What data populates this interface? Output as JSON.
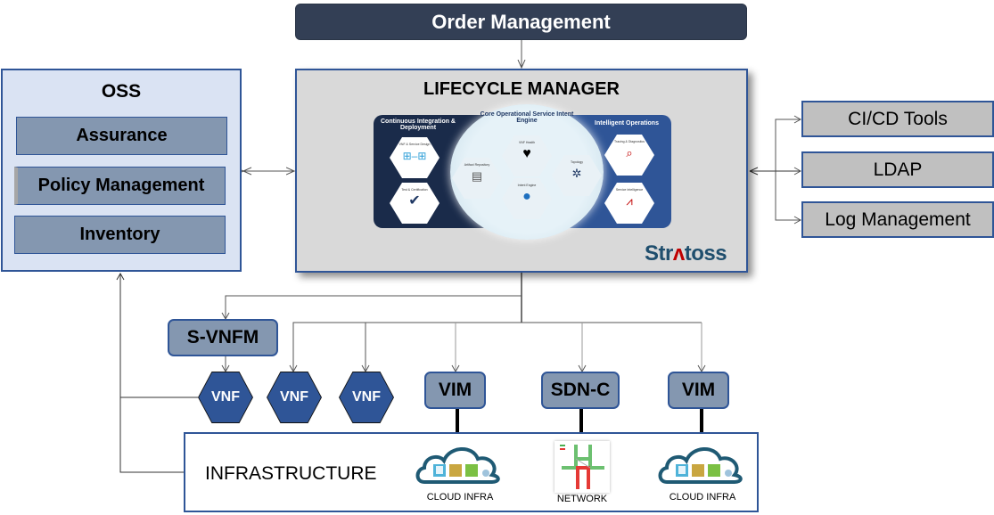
{
  "order_management": {
    "label": "Order Management"
  },
  "oss": {
    "title": "OSS",
    "items": [
      {
        "label": "Assurance"
      },
      {
        "label": "Policy Management"
      },
      {
        "label": "Inventory"
      }
    ]
  },
  "lifecycle_manager": {
    "title": "LIFECYCLE MANAGER",
    "brand": {
      "prefix": "Str",
      "accent": "ʌ",
      "suffix": "toss",
      "brand_color": "#1f4e6d",
      "accent_color": "#c00000"
    },
    "sections": {
      "ci_cd": {
        "title": "Continuous Integration & Deployment",
        "tiles": [
          {
            "label": "VNF & Service Design",
            "icon": "workflow-icon"
          },
          {
            "label": "Test & Certification",
            "icon": "check-gear-icon"
          }
        ]
      },
      "core": {
        "title": "Core Operational Service Intent Engine",
        "tiles": [
          {
            "label": "VNF Health",
            "icon": "heartbeat-icon"
          },
          {
            "label": "Artifact Repository",
            "icon": "repository-icon"
          },
          {
            "label": "Intent Engine",
            "icon": "engine-icon"
          },
          {
            "label": "Topology",
            "icon": "topology-icon"
          }
        ]
      },
      "intelligent_ops": {
        "title": "Intelligent Operations",
        "tiles": [
          {
            "label": "Tracing & Diagnostics",
            "icon": "magnifier-icon"
          },
          {
            "label": "Service Intelligence",
            "icon": "line-chart-icon"
          }
        ]
      }
    }
  },
  "tools": [
    {
      "label": "CI/CD Tools"
    },
    {
      "label": "LDAP"
    },
    {
      "label": "Log Management"
    }
  ],
  "managers": {
    "svnfm": {
      "label": "S-VNFM"
    },
    "vim_left": {
      "label": "VIM"
    },
    "sdn_c": {
      "label": "SDN-C"
    },
    "vim_right": {
      "label": "VIM"
    }
  },
  "vnfs": [
    {
      "label": "VNF"
    },
    {
      "label": "VNF"
    },
    {
      "label": "VNF"
    }
  ],
  "infrastructure": {
    "title": "INFRASTRUCTURE",
    "items": [
      {
        "label": "CLOUD INFRA",
        "icon": "cloud-icon"
      },
      {
        "label": "NETWORK",
        "icon": "network-icon"
      },
      {
        "label": "CLOUD INFRA",
        "icon": "cloud-icon"
      }
    ]
  },
  "colors": {
    "dark_navy": "#333f55",
    "blue_border": "#2f5597",
    "slate": "#8497b0",
    "light_blue": "#dae3f3",
    "grey_box": "#c0c0c0"
  }
}
